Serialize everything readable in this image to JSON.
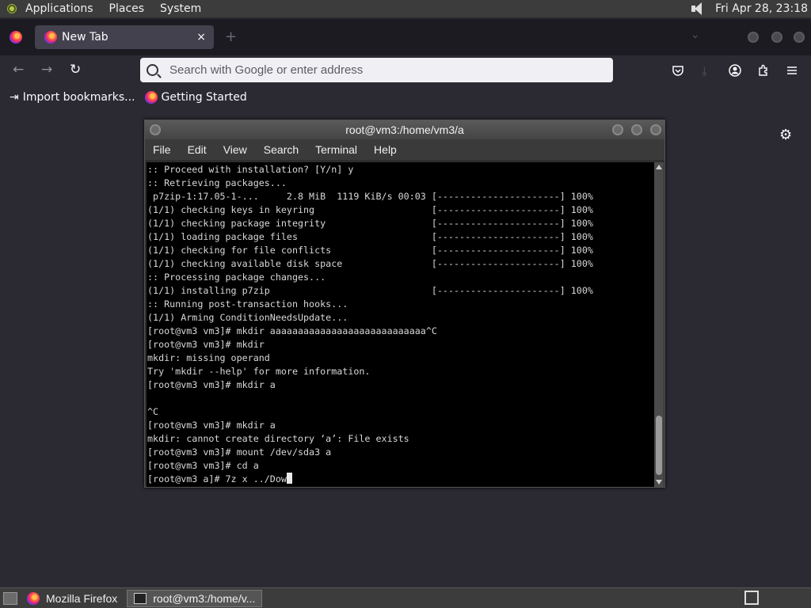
{
  "topbar": {
    "menus": [
      "Applications",
      "Places",
      "System"
    ],
    "clock": "Fri Apr 28, 23:18"
  },
  "browser": {
    "tab": {
      "title": "New Tab",
      "close": "×"
    },
    "new_tab": "+",
    "url_placeholder": "Search with Google or enter address",
    "bookmarks": [
      "Import bookmarks...",
      "Getting Started"
    ]
  },
  "terminal": {
    "title": "root@vm3:/home/vm3/a",
    "menus": [
      "File",
      "Edit",
      "View",
      "Search",
      "Terminal",
      "Help"
    ],
    "lines": [
      ":: Proceed with installation? [Y/n] y",
      ":: Retrieving packages...",
      " p7zip-1:17.05-1-...     2.8 MiB  1119 KiB/s 00:03 [----------------------] 100%",
      "(1/1) checking keys in keyring                     [----------------------] 100%",
      "(1/1) checking package integrity                   [----------------------] 100%",
      "(1/1) loading package files                        [----------------------] 100%",
      "(1/1) checking for file conflicts                  [----------------------] 100%",
      "(1/1) checking available disk space                [----------------------] 100%",
      ":: Processing package changes...",
      "(1/1) installing p7zip                             [----------------------] 100%",
      ":: Running post-transaction hooks...",
      "(1/1) Arming ConditionNeedsUpdate...",
      "[root@vm3 vm3]# mkdir aaaaaaaaaaaaaaaaaaaaaaaaaaaa^C",
      "[root@vm3 vm3]# mkdir",
      "mkdir: missing operand",
      "Try 'mkdir --help' for more information.",
      "[root@vm3 vm3]# mkdir a",
      "",
      "^C",
      "[root@vm3 vm3]# mkdir a",
      "mkdir: cannot create directory ‘a’: File exists",
      "[root@vm3 vm3]# mount /dev/sda3 a",
      "[root@vm3 vm3]# cd a"
    ],
    "prompt_line": "[root@vm3 a]# 7z x ../Dow"
  },
  "taskbar": {
    "tasks": [
      "Mozilla Firefox",
      "root@vm3:/home/v..."
    ]
  }
}
